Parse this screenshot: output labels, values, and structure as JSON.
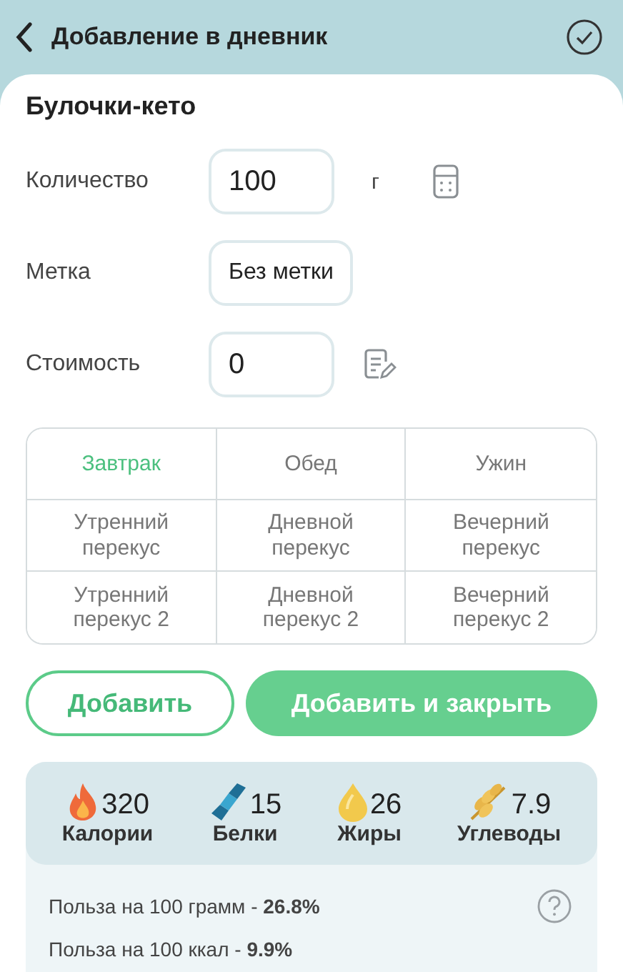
{
  "header": {
    "title": "Добавление в дневник"
  },
  "product": {
    "name": "Булочки-кето"
  },
  "fields": [
    {
      "kind": "quantity",
      "label": "Количество",
      "value": "100",
      "unit": "г"
    },
    {
      "kind": "tag",
      "label": "Метка",
      "value": "Без метки"
    },
    {
      "kind": "cost",
      "label": "Стоимость",
      "value": "0"
    }
  ],
  "meals": [
    {
      "label": "Завтрак",
      "selected": true
    },
    {
      "label": "Обед",
      "selected": false
    },
    {
      "label": "Ужин",
      "selected": false
    },
    {
      "label": "Утренний перекус",
      "selected": false
    },
    {
      "label": "Дневной перекус",
      "selected": false
    },
    {
      "label": "Вечерний перекус",
      "selected": false
    },
    {
      "label": "Утренний перекус 2",
      "selected": false
    },
    {
      "label": "Дневной перекус 2",
      "selected": false
    },
    {
      "label": "Вечерний перекус 2",
      "selected": false
    }
  ],
  "buttons": [
    {
      "kind": "outline",
      "label": "Добавить"
    },
    {
      "kind": "filled",
      "label": "Добавить и закрыть"
    }
  ],
  "nutrients": [
    {
      "kind": "calories",
      "value": "320",
      "label": "Калории"
    },
    {
      "kind": "protein",
      "value": "15",
      "label": "Белки"
    },
    {
      "kind": "fat",
      "value": "26",
      "label": "Жиры"
    },
    {
      "kind": "carbs",
      "value": "7.9",
      "label": "Углеводы"
    }
  ],
  "benefits": [
    "Польза на 100 грамм - **26.8%**",
    "Польза на 100 ккал - **9.9%**"
  ]
}
